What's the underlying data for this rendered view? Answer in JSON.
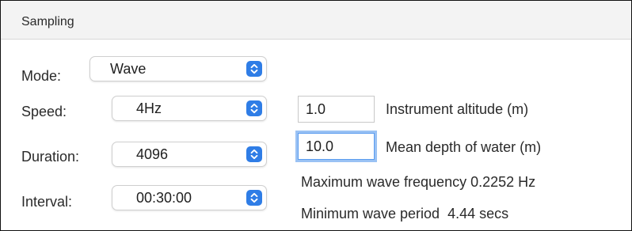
{
  "section": {
    "title": "Sampling"
  },
  "mode": {
    "label": "Mode:",
    "value": "Wave"
  },
  "speed": {
    "label": "Speed:",
    "value": "4Hz"
  },
  "duration": {
    "label": "Duration:",
    "value": "4096"
  },
  "interval": {
    "label": "Interval:",
    "value": "00:30:00"
  },
  "altitude": {
    "value": "1.0",
    "label": "Instrument altitude (m)"
  },
  "depth": {
    "value": "10.0",
    "label": "Mean depth of water (m)"
  },
  "info": {
    "max_wave_frequency": "Maximum wave frequency 0.2252 Hz",
    "min_wave_period": "Minimum wave period  4.44 secs"
  },
  "icons": {
    "popup_stepper": "up-down-chevron-icon"
  },
  "colors": {
    "accent": "#2f7de6",
    "focus_ring": "#9ac2f4",
    "header_bg": "#f3f3f3"
  }
}
